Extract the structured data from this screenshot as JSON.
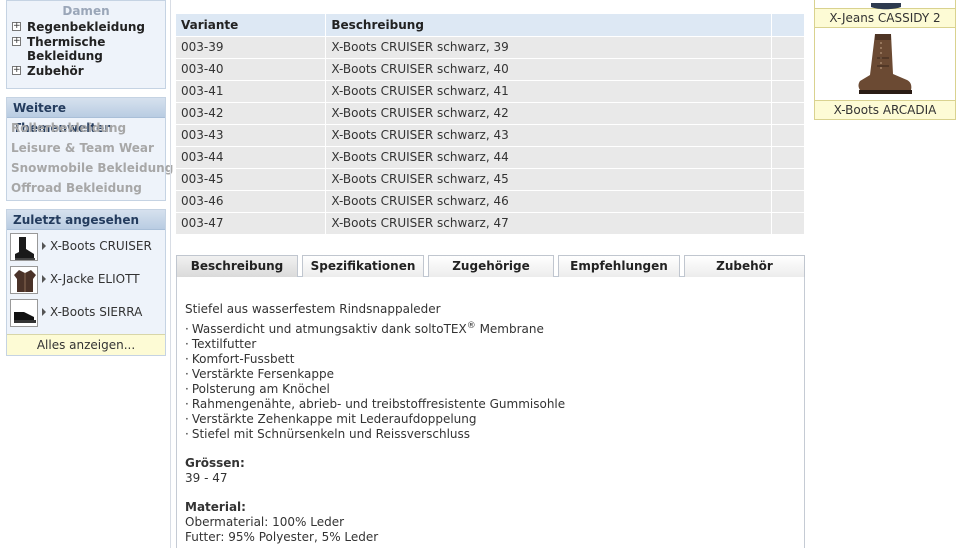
{
  "sidebar": {
    "category_header": "Damen",
    "categories": [
      {
        "label": "Regenbekleidung"
      },
      {
        "label": "Thermische Bekleidung"
      },
      {
        "label": "Zubehör"
      }
    ],
    "themes_title": "Weitere Themenwelten",
    "themes": [
      "Rollerbekleidung",
      "Leisure & Team Wear",
      "Snowmobile Bekleidung",
      "Offroad Bekleidung"
    ],
    "recent_title": "Zuletzt angesehen",
    "recent": [
      {
        "label": "X-Boots CRUISER",
        "icon": "boot-thumbnail"
      },
      {
        "label": "X-Jacke ELIOTT",
        "icon": "jacket-thumbnail"
      },
      {
        "label": "X-Boots SIERRA",
        "icon": "boot-thumbnail"
      }
    ],
    "show_all": "Alles anzeigen..."
  },
  "variants_table": {
    "headers": [
      "Variante",
      "Beschreibung"
    ],
    "rows": [
      {
        "variant": "003-39",
        "desc": "X-Boots CRUISER schwarz, 39"
      },
      {
        "variant": "003-40",
        "desc": "X-Boots CRUISER schwarz, 40"
      },
      {
        "variant": "003-41",
        "desc": "X-Boots CRUISER schwarz, 41"
      },
      {
        "variant": "003-42",
        "desc": "X-Boots CRUISER schwarz, 42"
      },
      {
        "variant": "003-43",
        "desc": "X-Boots CRUISER schwarz, 43"
      },
      {
        "variant": "003-44",
        "desc": "X-Boots CRUISER schwarz, 44"
      },
      {
        "variant": "003-45",
        "desc": "X-Boots CRUISER schwarz, 45"
      },
      {
        "variant": "003-46",
        "desc": "X-Boots CRUISER schwarz, 46"
      },
      {
        "variant": "003-47",
        "desc": "X-Boots CRUISER schwarz, 47"
      }
    ]
  },
  "tabs": [
    {
      "label": "Beschreibung",
      "active": true
    },
    {
      "label": "Spezifikationen"
    },
    {
      "label": "Zugehörige Dateien"
    },
    {
      "label": "Empfehlungen"
    },
    {
      "label": "Zubehör"
    }
  ],
  "description": {
    "intro": "Stiefel aus wasserfestem Rindsnappaleder",
    "features": [
      "Wasserdicht und atmungsaktiv dank soltoTEX",
      "Textilfutter",
      "Komfort-Fussbett",
      "Verstärkte Fersenkappe",
      "Polsterung am Knöchel",
      "Rahmengenähte, abrieb- und treibstoffresistente Gummisohle",
      "Verstärkte Zehenkappe mit Lederaufdoppelung",
      "Stiefel mit Schnürsenkeln und Reissverschluss"
    ],
    "feature0_sup": "®",
    "feature0_suffix": " Membrane",
    "bullet": "·",
    "sizes_label": "Grössen:",
    "sizes_value": "39 - 47",
    "material_label": "Material:",
    "material_lines": [
      "Obermaterial: 100% Leder",
      "Futter: 95% Polyester, 5% Leder"
    ]
  },
  "related": [
    {
      "label": "X-Jeans CASSIDY 2"
    },
    {
      "label": "X-Boots ARCADIA",
      "icon": "brown-boot-image"
    }
  ],
  "colors": {
    "sidebar_bg": "#eef3fa",
    "title_bar": "#c8d8ea",
    "table_header": "#dde8f4",
    "table_row": "#e9e9e9",
    "label_yellow": "#fdfbd5"
  }
}
